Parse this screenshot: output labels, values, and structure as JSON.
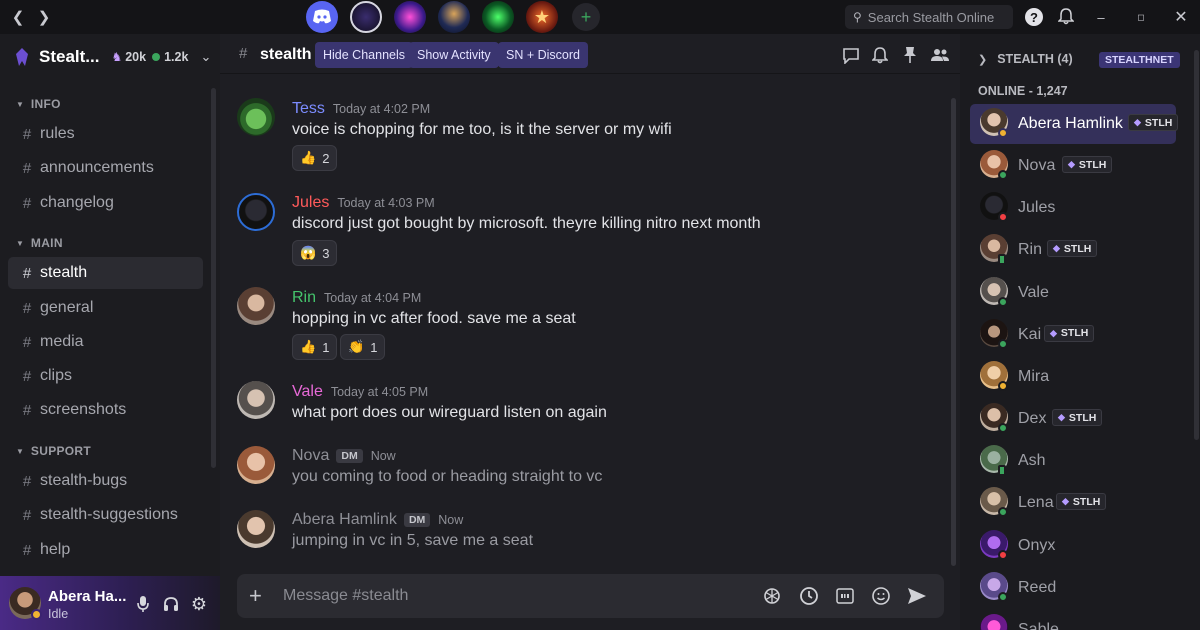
{
  "search": {
    "placeholder": "Search Stealth Online"
  },
  "server": {
    "name": "Stealt...",
    "members": "20k",
    "online": "1.2k"
  },
  "sidebar": {
    "categories": [
      {
        "label": "INFO",
        "channels": [
          "rules",
          "announcements",
          "changelog"
        ]
      },
      {
        "label": "MAIN",
        "channels": [
          "stealth",
          "general",
          "media",
          "clips",
          "screenshots"
        ]
      },
      {
        "label": "SUPPORT",
        "channels": [
          "stealth-bugs",
          "stealth-suggestions",
          "help"
        ]
      }
    ],
    "active_channel": "stealth"
  },
  "user": {
    "name": "Abera Ha...",
    "status": "Idle"
  },
  "header": {
    "channel": "stealth",
    "buttons": [
      "Hide Channels",
      "Show Activity",
      "SN + Discord"
    ]
  },
  "messages": [
    {
      "author": "Tess",
      "color": "#7c8cff",
      "time": "Today at 4:02 PM",
      "text": "voice is chopping for me too, is it the server or my wifi",
      "reactions": [
        {
          "emoji": "👍",
          "count": "2"
        }
      ]
    },
    {
      "author": "Jules",
      "color": "#ff5a5a",
      "time": "Today at 4:03 PM",
      "text": "discord just got bought by microsoft. theyre killing nitro next month",
      "reactions": [
        {
          "emoji": "😱",
          "count": "3"
        }
      ]
    },
    {
      "author": "Rin",
      "color": "#45c46c",
      "time": "Today at 4:04 PM",
      "text": "hopping in vc after food. save me a seat",
      "reactions": [
        {
          "emoji": "👍",
          "count": "1"
        },
        {
          "emoji": "👏",
          "count": "1"
        }
      ]
    },
    {
      "author": "Vale",
      "color": "#e86ad8",
      "time": "Today at 4:05 PM",
      "text": "what port does our wireguard listen on again",
      "reactions": []
    },
    {
      "author": "Nova",
      "color": "#8e8f96",
      "badge": "DM",
      "time": "Now",
      "text": "you coming to food or heading straight to vc",
      "reactions": []
    },
    {
      "author": "Abera Hamlink",
      "color": "#8e8f96",
      "badge": "DM",
      "time": "Now",
      "text": "jumping in vc in 5, save me a seat",
      "reactions": []
    }
  ],
  "composer": {
    "placeholder": "Message #stealth"
  },
  "members_panel": {
    "group_label": "STEALTH (4)",
    "network_badge": "STEALTHNET",
    "online_label": "ONLINE - 1,247",
    "members": [
      {
        "name": "Abera Hamlink",
        "tag": "STLH",
        "status": "idle"
      },
      {
        "name": "Nova",
        "tag": "STLH",
        "status": "online"
      },
      {
        "name": "Jules",
        "tag": "",
        "status": "dnd"
      },
      {
        "name": "Rin",
        "tag": "STLH",
        "status": "mobile"
      },
      {
        "name": "Vale",
        "tag": "",
        "status": "online"
      },
      {
        "name": "Kai",
        "tag": "STLH",
        "status": "online"
      },
      {
        "name": "Mira",
        "tag": "",
        "status": "idle"
      },
      {
        "name": "Dex",
        "tag": "STLH",
        "status": "online"
      },
      {
        "name": "Ash",
        "tag": "",
        "status": "mobile"
      },
      {
        "name": "Lena",
        "tag": "STLH",
        "status": "online"
      },
      {
        "name": "Onyx",
        "tag": "",
        "status": "dnd"
      },
      {
        "name": "Reed",
        "tag": "",
        "status": "online"
      },
      {
        "name": "Sable",
        "tag": "",
        "status": "online"
      }
    ]
  },
  "colors": {
    "accent": "#3a3570",
    "online": "#3ba55d",
    "idle": "#f0b232",
    "dnd": "#f23f43"
  }
}
